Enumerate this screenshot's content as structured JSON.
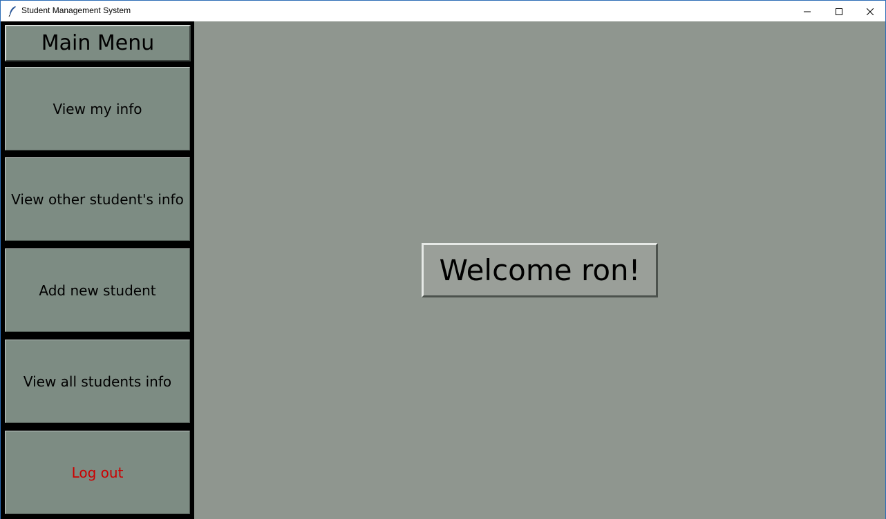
{
  "window": {
    "title": "Student Management System",
    "icon": "feather-icon",
    "controls": [
      "minimize-icon",
      "maximize-icon",
      "close-icon"
    ]
  },
  "sidebar": {
    "title": "Main Menu",
    "items": [
      {
        "label": "View my info"
      },
      {
        "label": "View other student's info"
      },
      {
        "label": "Add new student"
      },
      {
        "label": "View all students info"
      },
      {
        "label": "Log out"
      }
    ]
  },
  "main": {
    "welcome": "Welcome ron!"
  },
  "colors": {
    "background": "#8f968f",
    "button": "#7d8c83",
    "sidebar": "#000000",
    "logout_text": "#cc0000"
  }
}
